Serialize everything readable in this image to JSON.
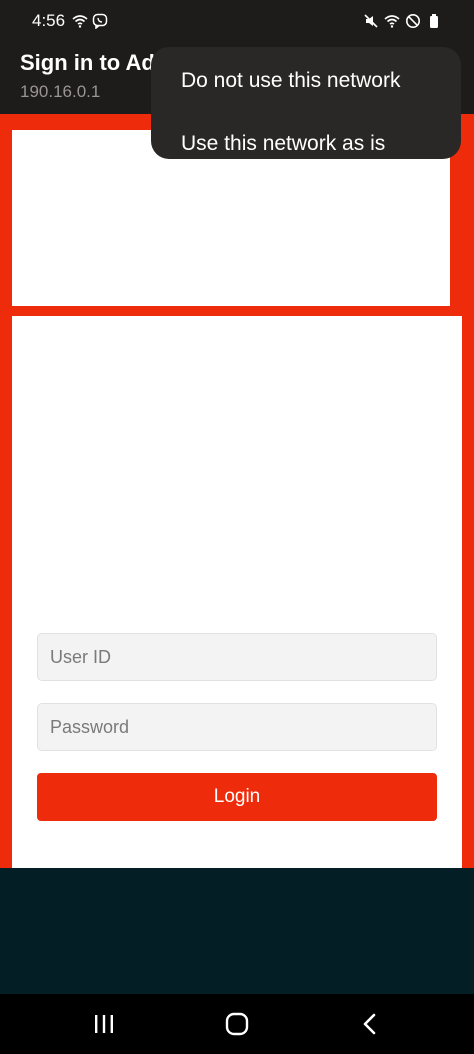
{
  "status_bar": {
    "time": "4:56",
    "left_icons": [
      "wifi-icon",
      "viber-icon"
    ],
    "right_icons": [
      "mute-icon",
      "wifi-icon",
      "do-not-disturb-icon",
      "battery-icon"
    ]
  },
  "app_bar": {
    "title": "Sign in to Ad",
    "subtitle": "190.16.0.1"
  },
  "menu": {
    "items": [
      {
        "label": "Do not use this network"
      },
      {
        "label": "Use this network as is"
      }
    ]
  },
  "login_form": {
    "user_placeholder": "User ID",
    "password_placeholder": "Password",
    "login_label": "Login"
  },
  "nav_bar": {
    "buttons": [
      "recent-apps",
      "home",
      "back"
    ]
  },
  "colors": {
    "brand": "#ee2c0c",
    "dark_bar": "#1e1b1b",
    "footer": "#031e24",
    "menu_bg": "#2a2727"
  }
}
